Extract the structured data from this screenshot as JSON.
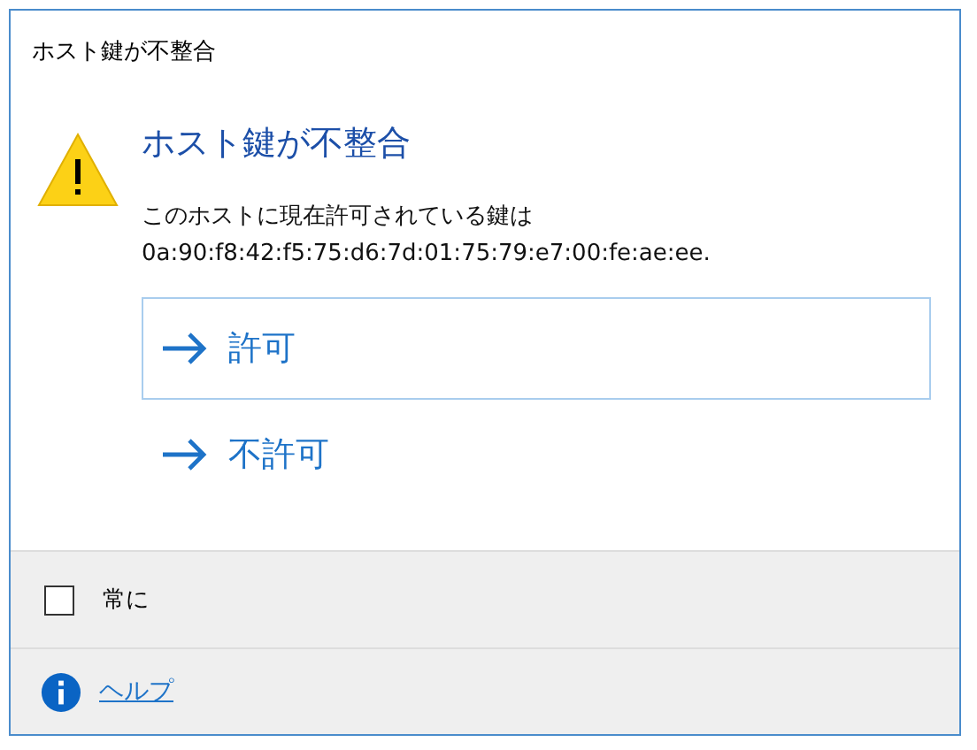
{
  "window": {
    "title": "ホスト鍵が不整合"
  },
  "heading": "ホスト鍵が不整合",
  "message": [
    "このホストに現在許可されている鍵は",
    "0a:90:f8:42:f5:75:d6:7d:01:75:79:e7:00:fe:ae:ee."
  ],
  "options": [
    {
      "label": "許可",
      "selected": true
    },
    {
      "label": "不許可",
      "selected": false
    }
  ],
  "always": {
    "label": "常に",
    "checked": false
  },
  "help": {
    "label": "ヘルプ"
  }
}
